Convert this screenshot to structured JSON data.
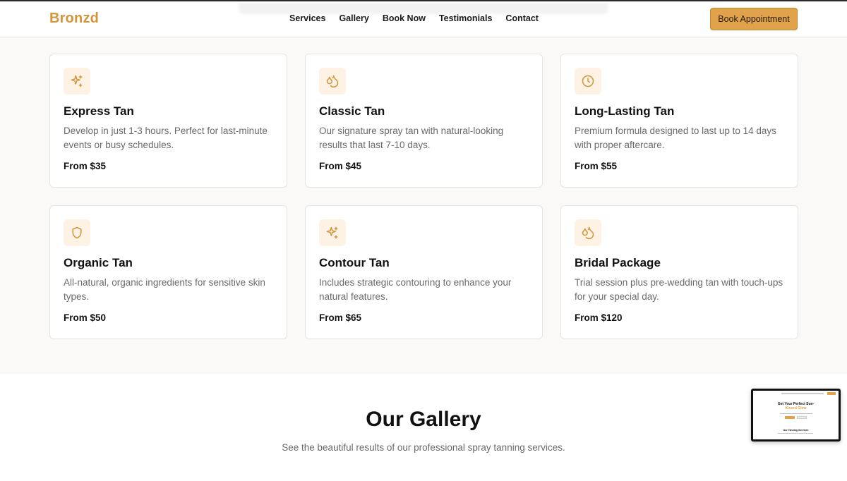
{
  "brand": {
    "name": "Bronzd",
    "accent": "#d4953a",
    "button_color": "#e0a24a"
  },
  "nav": {
    "items": [
      {
        "label": "Services"
      },
      {
        "label": "Gallery"
      },
      {
        "label": "Book Now"
      },
      {
        "label": "Testimonials"
      },
      {
        "label": "Contact"
      }
    ],
    "cta_label": "Book Appointment"
  },
  "services": [
    {
      "icon": "sparkles-icon",
      "title": "Express Tan",
      "description": "Develop in just 1-3 hours. Perfect for last-minute events or busy schedules.",
      "price": "From $35"
    },
    {
      "icon": "droplets-icon",
      "title": "Classic Tan",
      "description": "Our signature spray tan with natural-looking results that last 7-10 days.",
      "price": "From $45"
    },
    {
      "icon": "clock-icon",
      "title": "Long-Lasting Tan",
      "description": "Premium formula designed to last up to 14 days with proper aftercare.",
      "price": "From $55"
    },
    {
      "icon": "shield-icon",
      "title": "Organic Tan",
      "description": "All-natural, organic ingredients for sensitive skin types.",
      "price": "From $50"
    },
    {
      "icon": "sparkles-icon",
      "title": "Contour Tan",
      "description": "Includes strategic contouring to enhance your natural features.",
      "price": "From $65"
    },
    {
      "icon": "droplets-icon",
      "title": "Bridal Package",
      "description": "Trial session plus pre-wedding tan with touch-ups for your special day.",
      "price": "From $120"
    }
  ],
  "gallery": {
    "title": "Our Gallery",
    "subtitle": "See the beautiful results of our professional spray tanning services."
  },
  "preview_thumbnail": {
    "title_line1": "Get Your Perfect Sun-",
    "title_line2": "Kissed Glow",
    "section_title": "Our Tanning Services"
  }
}
